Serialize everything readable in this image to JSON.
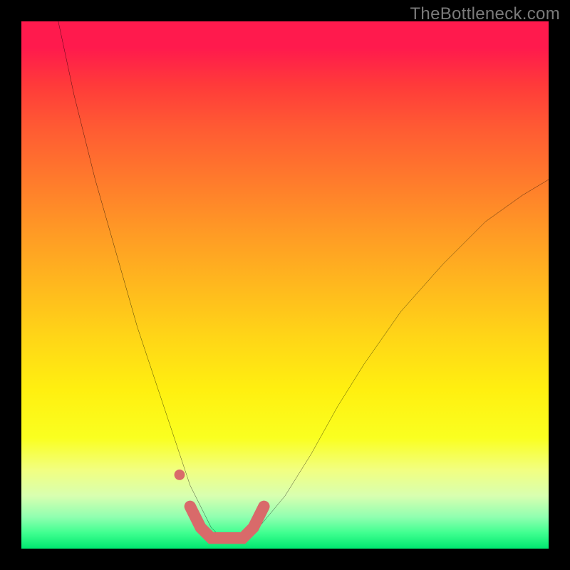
{
  "watermark": "TheBottleneck.com",
  "chart_data": {
    "type": "line",
    "title": "",
    "xlabel": "",
    "ylabel": "",
    "xlim": [
      0,
      100
    ],
    "ylim": [
      0,
      100
    ],
    "gradient_stops": [
      {
        "pct": 0,
        "color": "#ff1a4d"
      },
      {
        "pct": 5,
        "color": "#ff1a4d"
      },
      {
        "pct": 12,
        "color": "#ff3a3a"
      },
      {
        "pct": 20,
        "color": "#ff5a33"
      },
      {
        "pct": 30,
        "color": "#ff7a2c"
      },
      {
        "pct": 40,
        "color": "#ff9a25"
      },
      {
        "pct": 50,
        "color": "#ffb81e"
      },
      {
        "pct": 60,
        "color": "#ffd617"
      },
      {
        "pct": 70,
        "color": "#fff010"
      },
      {
        "pct": 79,
        "color": "#faff20"
      },
      {
        "pct": 85,
        "color": "#f2ff80"
      },
      {
        "pct": 90,
        "color": "#d8ffb0"
      },
      {
        "pct": 94,
        "color": "#90ffb0"
      },
      {
        "pct": 97,
        "color": "#40ff90"
      },
      {
        "pct": 100,
        "color": "#00e870"
      }
    ],
    "series": [
      {
        "name": "bottleneck-curve",
        "color": "#000000",
        "stroke_width": 2.5,
        "x": [
          7,
          10,
          14,
          18,
          22,
          26,
          30,
          32,
          34,
          36,
          38,
          40,
          42,
          45,
          50,
          55,
          60,
          65,
          72,
          80,
          88,
          95,
          100
        ],
        "y": [
          100,
          86,
          70,
          56,
          42,
          30,
          18,
          12,
          8,
          4,
          2,
          2,
          2,
          4,
          10,
          18,
          27,
          35,
          45,
          54,
          62,
          67,
          70
        ]
      },
      {
        "name": "marker-band",
        "color": "#d96a6a",
        "stroke_width": 16,
        "linecap": "round",
        "marker_dot": {
          "x": 30,
          "y": 14,
          "r": 7
        },
        "x": [
          32,
          34,
          36,
          38,
          40,
          42,
          44,
          46
        ],
        "y": [
          8,
          4,
          2,
          2,
          2,
          2,
          4,
          8
        ]
      }
    ]
  }
}
